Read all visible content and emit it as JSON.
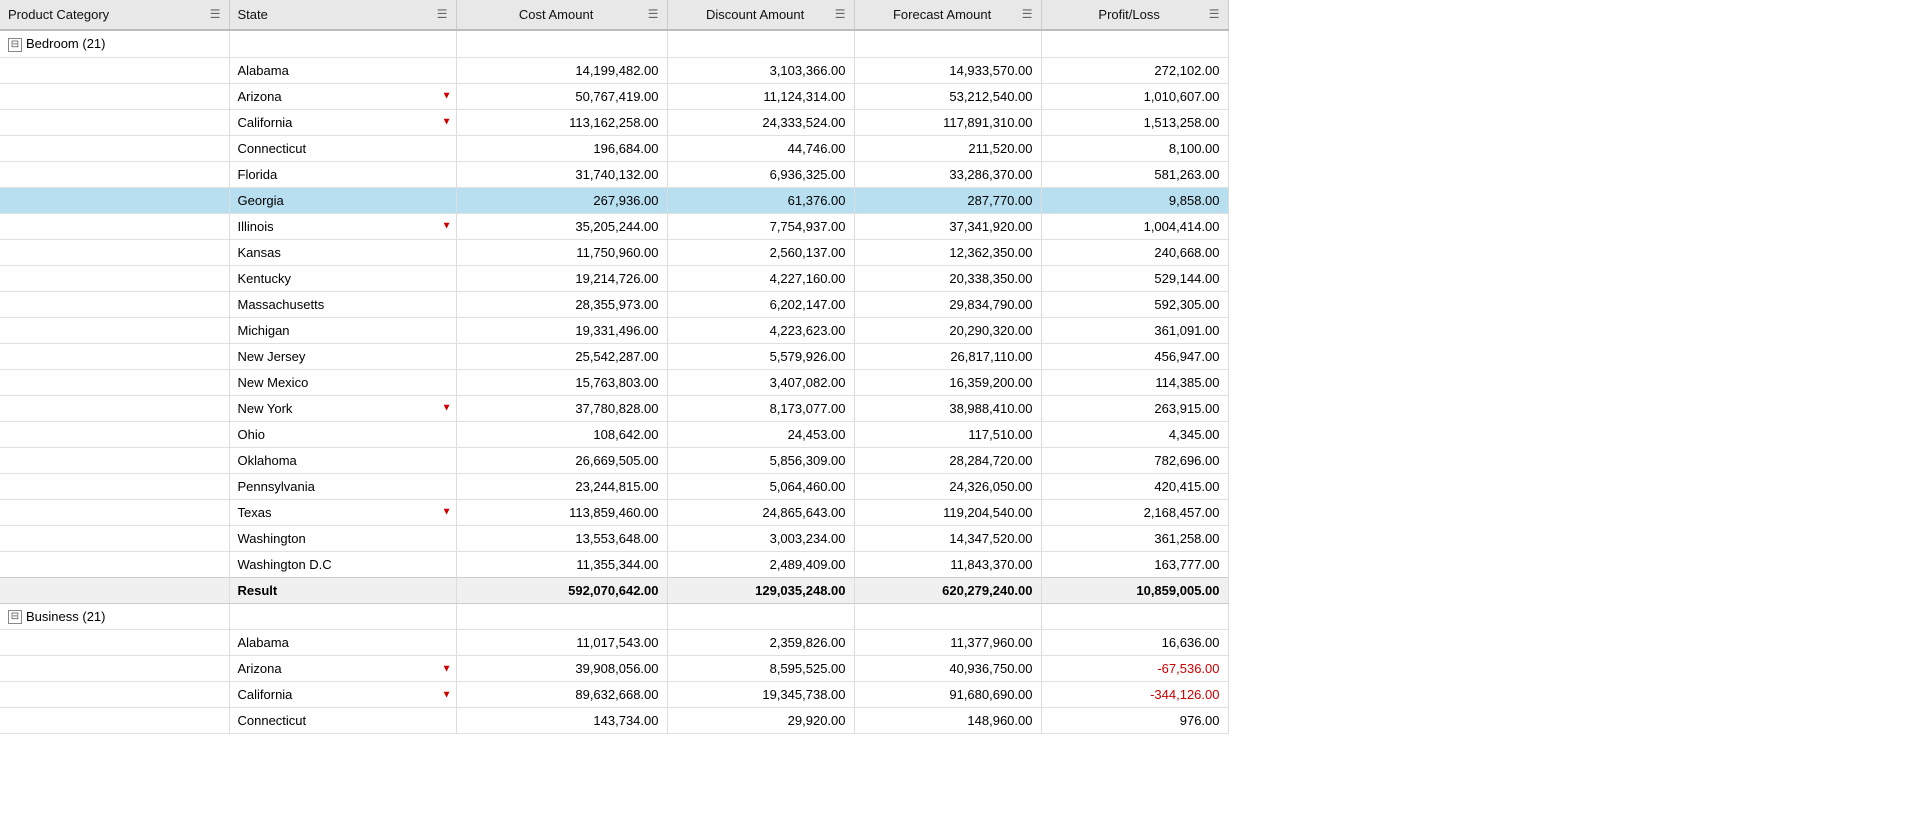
{
  "headers": [
    {
      "key": "product_category",
      "label": "Product Category",
      "class": "col-product"
    },
    {
      "key": "state",
      "label": "State",
      "class": "col-state"
    },
    {
      "key": "cost_amount",
      "label": "Cost Amount",
      "class": "col-cost"
    },
    {
      "key": "discount_amount",
      "label": "Discount Amount",
      "class": "col-discount"
    },
    {
      "key": "forecast_amount",
      "label": "Forecast Amount",
      "class": "col-forecast"
    },
    {
      "key": "profit_loss",
      "label": "Profit/Loss",
      "class": "col-profit"
    }
  ],
  "bedroom_group": {
    "label": "Bedroom (21)",
    "rows": [
      {
        "state": "Alabama",
        "filter": false,
        "cost": "14,199,482.00",
        "discount": "3,103,366.00",
        "forecast": "14,933,570.00",
        "profit": "272,102.00",
        "highlighted": false
      },
      {
        "state": "Arizona",
        "filter": true,
        "cost": "50,767,419.00",
        "discount": "11,124,314.00",
        "forecast": "53,212,540.00",
        "profit": "1,010,607.00",
        "highlighted": false
      },
      {
        "state": "California",
        "filter": true,
        "cost": "113,162,258.00",
        "discount": "24,333,524.00",
        "forecast": "117,891,310.00",
        "profit": "1,513,258.00",
        "highlighted": false
      },
      {
        "state": "Connecticut",
        "filter": false,
        "cost": "196,684.00",
        "discount": "44,746.00",
        "forecast": "211,520.00",
        "profit": "8,100.00",
        "highlighted": false
      },
      {
        "state": "Florida",
        "filter": false,
        "cost": "31,740,132.00",
        "discount": "6,936,325.00",
        "forecast": "33,286,370.00",
        "profit": "581,263.00",
        "highlighted": false
      },
      {
        "state": "Georgia",
        "filter": false,
        "cost": "267,936.00",
        "discount": "61,376.00",
        "forecast": "287,770.00",
        "profit": "9,858.00",
        "highlighted": true
      },
      {
        "state": "Illinois",
        "filter": true,
        "cost": "35,205,244.00",
        "discount": "7,754,937.00",
        "forecast": "37,341,920.00",
        "profit": "1,004,414.00",
        "highlighted": false
      },
      {
        "state": "Kansas",
        "filter": false,
        "cost": "11,750,960.00",
        "discount": "2,560,137.00",
        "forecast": "12,362,350.00",
        "profit": "240,668.00",
        "highlighted": false
      },
      {
        "state": "Kentucky",
        "filter": false,
        "cost": "19,214,726.00",
        "discount": "4,227,160.00",
        "forecast": "20,338,350.00",
        "profit": "529,144.00",
        "highlighted": false
      },
      {
        "state": "Massachusetts",
        "filter": false,
        "cost": "28,355,973.00",
        "discount": "6,202,147.00",
        "forecast": "29,834,790.00",
        "profit": "592,305.00",
        "highlighted": false
      },
      {
        "state": "Michigan",
        "filter": false,
        "cost": "19,331,496.00",
        "discount": "4,223,623.00",
        "forecast": "20,290,320.00",
        "profit": "361,091.00",
        "highlighted": false
      },
      {
        "state": "New Jersey",
        "filter": false,
        "cost": "25,542,287.00",
        "discount": "5,579,926.00",
        "forecast": "26,817,110.00",
        "profit": "456,947.00",
        "highlighted": false
      },
      {
        "state": "New Mexico",
        "filter": false,
        "cost": "15,763,803.00",
        "discount": "3,407,082.00",
        "forecast": "16,359,200.00",
        "profit": "114,385.00",
        "highlighted": false
      },
      {
        "state": "New York",
        "filter": true,
        "cost": "37,780,828.00",
        "discount": "8,173,077.00",
        "forecast": "38,988,410.00",
        "profit": "263,915.00",
        "highlighted": false
      },
      {
        "state": "Ohio",
        "filter": false,
        "cost": "108,642.00",
        "discount": "24,453.00",
        "forecast": "117,510.00",
        "profit": "4,345.00",
        "highlighted": false
      },
      {
        "state": "Oklahoma",
        "filter": false,
        "cost": "26,669,505.00",
        "discount": "5,856,309.00",
        "forecast": "28,284,720.00",
        "profit": "782,696.00",
        "highlighted": false
      },
      {
        "state": "Pennsylvania",
        "filter": false,
        "cost": "23,244,815.00",
        "discount": "5,064,460.00",
        "forecast": "24,326,050.00",
        "profit": "420,415.00",
        "highlighted": false
      },
      {
        "state": "Texas",
        "filter": true,
        "cost": "113,859,460.00",
        "discount": "24,865,643.00",
        "forecast": "119,204,540.00",
        "profit": "2,168,457.00",
        "highlighted": false
      },
      {
        "state": "Washington",
        "filter": false,
        "cost": "13,553,648.00",
        "discount": "3,003,234.00",
        "forecast": "14,347,520.00",
        "profit": "361,258.00",
        "highlighted": false
      },
      {
        "state": "Washington D.C",
        "filter": false,
        "cost": "11,355,344.00",
        "discount": "2,489,409.00",
        "forecast": "11,843,370.00",
        "profit": "163,777.00",
        "highlighted": false
      }
    ],
    "result": {
      "label": "Result",
      "cost": "592,070,642.00",
      "discount": "129,035,248.00",
      "forecast": "620,279,240.00",
      "profit": "10,859,005.00"
    }
  },
  "business_group": {
    "label": "Business (21)",
    "rows": [
      {
        "state": "Alabama",
        "filter": false,
        "cost": "11,017,543.00",
        "discount": "2,359,826.00",
        "forecast": "11,377,960.00",
        "profit": "16,636.00",
        "highlighted": false
      },
      {
        "state": "Arizona",
        "filter": true,
        "cost": "39,908,056.00",
        "discount": "8,595,525.00",
        "forecast": "40,936,750.00",
        "profit": "-67,536.00",
        "highlighted": false,
        "negative_profit": true
      },
      {
        "state": "California",
        "filter": true,
        "cost": "89,632,668.00",
        "discount": "19,345,738.00",
        "forecast": "91,680,690.00",
        "profit": "-344,126.00",
        "highlighted": false,
        "negative_profit": true
      },
      {
        "state": "Connecticut",
        "filter": false,
        "cost": "143,734.00",
        "discount": "29,920.00",
        "forecast": "148,960.00",
        "profit": "976.00",
        "highlighted": false
      }
    ]
  }
}
